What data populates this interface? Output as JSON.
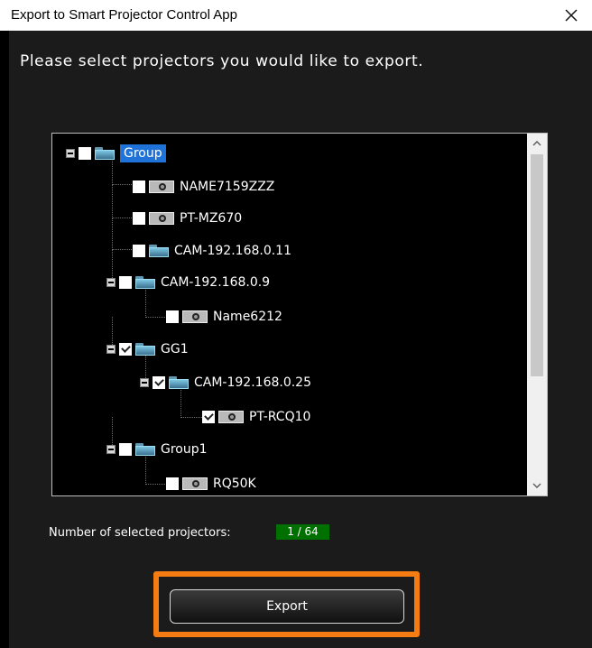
{
  "window": {
    "title": "Export to Smart Projector Control App"
  },
  "instruction": "Please select projectors you would like to export.",
  "tree": [
    {
      "label": "Group",
      "checked": false,
      "icon": "folder-icon",
      "level": 0,
      "expander": true,
      "selected": true
    },
    {
      "label": "NAME7159ZZZ",
      "checked": false,
      "icon": "projector-icon",
      "level": 1
    },
    {
      "label": "PT-MZ670",
      "checked": false,
      "icon": "projector-icon",
      "level": 1
    },
    {
      "label": "CAM-192.168.0.11",
      "checked": false,
      "icon": "folder-icon",
      "level": 1
    },
    {
      "label": "CAM-192.168.0.9",
      "checked": false,
      "icon": "folder-icon",
      "level": 1,
      "expander": true
    },
    {
      "label": "Name6212",
      "checked": false,
      "icon": "projector-icon",
      "level": 2
    },
    {
      "label": "GG1",
      "checked": true,
      "icon": "folder-icon",
      "level": 1,
      "expander": true
    },
    {
      "label": "CAM-192.168.0.25",
      "checked": true,
      "icon": "folder-icon",
      "level": 2,
      "expander": true
    },
    {
      "label": "PT-RCQ10",
      "checked": true,
      "icon": "projector-icon",
      "level": 3
    },
    {
      "label": "Group1",
      "checked": false,
      "icon": "folder-icon",
      "level": 1,
      "expander": true
    },
    {
      "label": "RQ50K",
      "checked": false,
      "icon": "projector-icon",
      "level": 2
    }
  ],
  "selection": {
    "label": "Number of selected projectors:",
    "value": "1 / 64"
  },
  "export_button": "Export",
  "colors": {
    "background": "#1b1b1b",
    "highlight": "#f47c12",
    "selected": "#1f73d8",
    "count": "#007000"
  }
}
